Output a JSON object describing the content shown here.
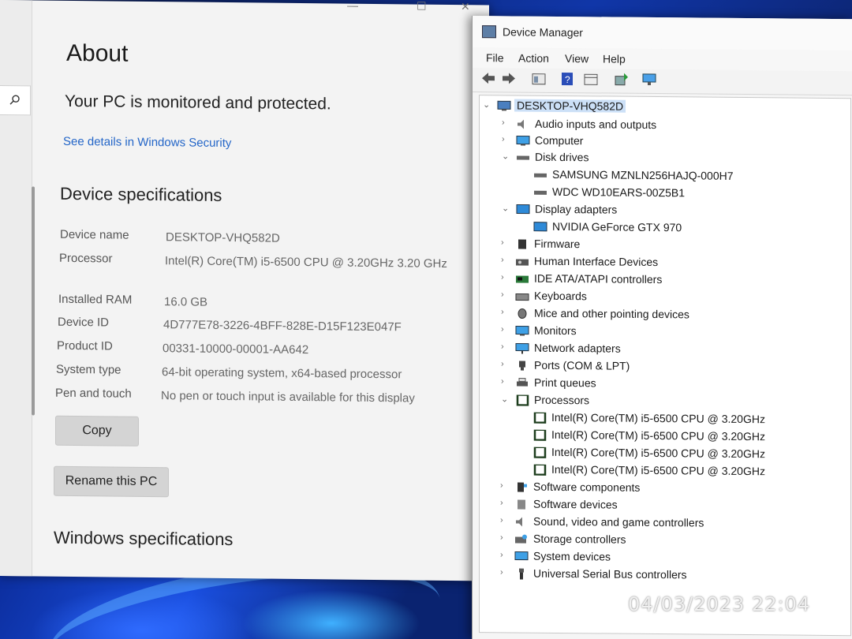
{
  "settings": {
    "title": "About",
    "protected_text": "Your PC is monitored and protected.",
    "security_link": "See details in Windows Security",
    "device_specs_title": "Device specifications",
    "specs": [
      {
        "label": "Device name",
        "value": "DESKTOP-VHQ582D"
      },
      {
        "label": "Processor",
        "value": "Intel(R) Core(TM) i5-6500 CPU @ 3.20GHz   3.20 GHz"
      },
      {
        "label": "Installed RAM",
        "value": "16.0 GB"
      },
      {
        "label": "Device ID",
        "value": "4D777E78-3226-4BFF-828E-D15F123E047F"
      },
      {
        "label": "Product ID",
        "value": "00331-10000-00001-AA642"
      },
      {
        "label": "System type",
        "value": "64-bit operating system, x64-based processor"
      },
      {
        "label": "Pen and touch",
        "value": "No pen or touch input is available for this display"
      }
    ],
    "copy_button": "Copy",
    "rename_button": "Rename this PC",
    "windows_specs_title": "Windows specifications"
  },
  "device_manager": {
    "title": "Device Manager",
    "menu": [
      "File",
      "Action",
      "View",
      "Help"
    ],
    "root": "DESKTOP-VHQ582D",
    "tree": [
      {
        "label": "Audio inputs and outputs",
        "expanded": false,
        "icon": "speaker-icon",
        "children": []
      },
      {
        "label": "Computer",
        "expanded": false,
        "icon": "monitor-icon",
        "children": []
      },
      {
        "label": "Disk drives",
        "expanded": true,
        "icon": "disk-icon",
        "children": [
          "SAMSUNG MZNLN256HAJQ-000H7",
          "WDC WD10EARS-00Z5B1"
        ]
      },
      {
        "label": "Display adapters",
        "expanded": true,
        "icon": "display-adapter-icon",
        "children": [
          "NVIDIA GeForce GTX 970"
        ]
      },
      {
        "label": "Firmware",
        "expanded": false,
        "icon": "chip-icon",
        "children": []
      },
      {
        "label": "Human Interface Devices",
        "expanded": false,
        "icon": "hid-icon",
        "children": []
      },
      {
        "label": "IDE ATA/ATAPI controllers",
        "expanded": false,
        "icon": "controller-icon",
        "children": []
      },
      {
        "label": "Keyboards",
        "expanded": false,
        "icon": "keyboard-icon",
        "children": []
      },
      {
        "label": "Mice and other pointing devices",
        "expanded": false,
        "icon": "mouse-icon",
        "children": []
      },
      {
        "label": "Monitors",
        "expanded": false,
        "icon": "monitor-icon",
        "children": []
      },
      {
        "label": "Network adapters",
        "expanded": false,
        "icon": "network-icon",
        "children": []
      },
      {
        "label": "Ports (COM & LPT)",
        "expanded": false,
        "icon": "port-icon",
        "children": []
      },
      {
        "label": "Print queues",
        "expanded": false,
        "icon": "printer-icon",
        "children": []
      },
      {
        "label": "Processors",
        "expanded": true,
        "icon": "processor-icon",
        "children": [
          "Intel(R) Core(TM) i5-6500 CPU @ 3.20GHz",
          "Intel(R) Core(TM) i5-6500 CPU @ 3.20GHz",
          "Intel(R) Core(TM) i5-6500 CPU @ 3.20GHz",
          "Intel(R) Core(TM) i5-6500 CPU @ 3.20GHz"
        ]
      },
      {
        "label": "Software components",
        "expanded": false,
        "icon": "software-icon",
        "children": []
      },
      {
        "label": "Software devices",
        "expanded": false,
        "icon": "software-device-icon",
        "children": []
      },
      {
        "label": "Sound, video and game controllers",
        "expanded": false,
        "icon": "speaker-icon",
        "children": []
      },
      {
        "label": "Storage controllers",
        "expanded": false,
        "icon": "storage-icon",
        "children": []
      },
      {
        "label": "System devices",
        "expanded": false,
        "icon": "system-icon",
        "children": []
      },
      {
        "label": "Universal Serial Bus controllers",
        "expanded": false,
        "icon": "usb-icon",
        "children": []
      }
    ]
  },
  "photo_timestamp": "04/03/2023  22:04"
}
